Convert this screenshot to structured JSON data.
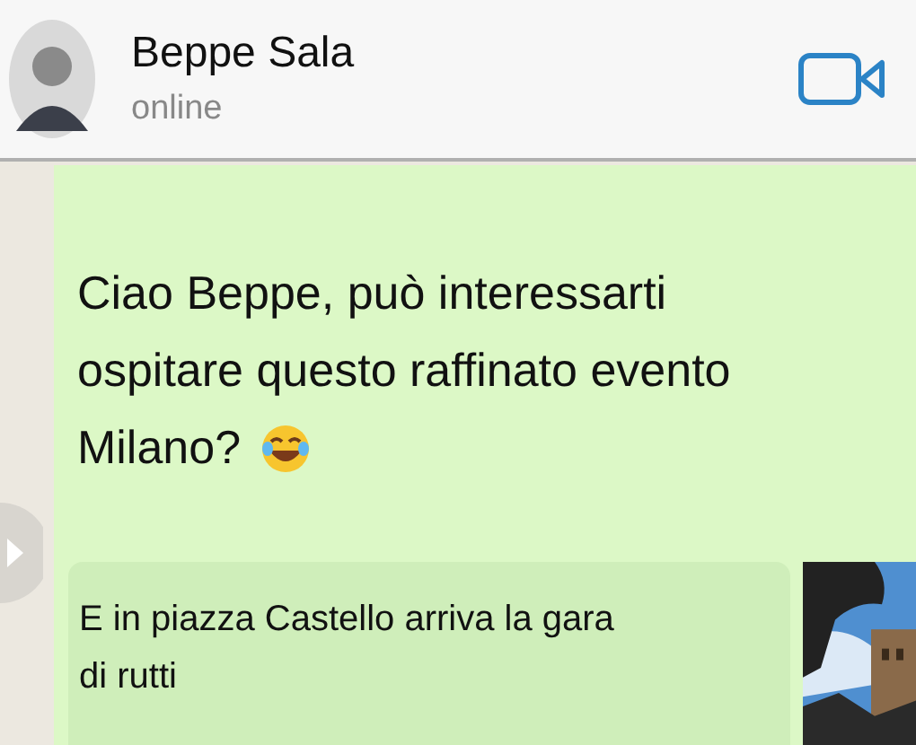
{
  "header": {
    "name": "Beppe Sala",
    "status": "online"
  },
  "message": {
    "lines": [
      "Ciao Beppe, può interessarti",
      "ospitare questo raffinato evento",
      "Milano?"
    ]
  },
  "link_preview": {
    "title_lines": [
      "E in piazza Castello arriva la gara",
      "di rutti"
    ],
    "thumbnail": {
      "kind": "picture"
    }
  }
}
